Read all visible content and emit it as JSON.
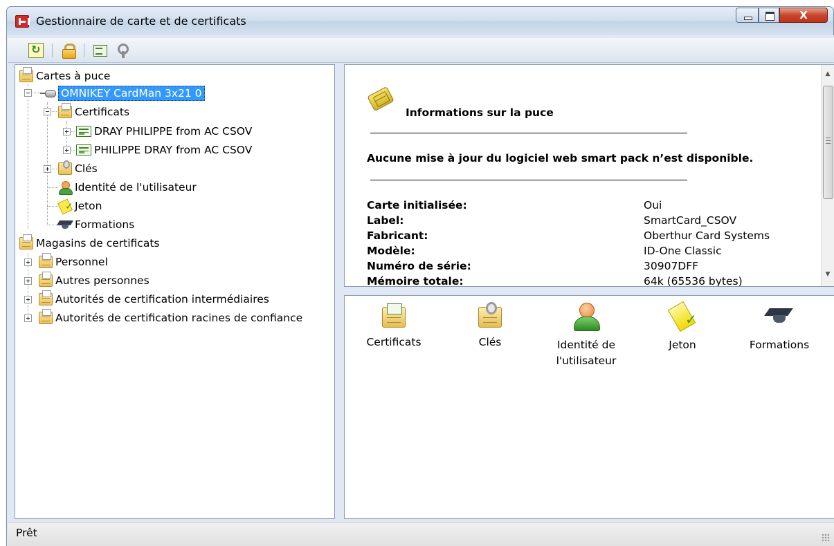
{
  "window": {
    "title": "Gestionnaire de carte et de certificats",
    "close_label": "X"
  },
  "toolbar": {
    "buttons": [
      {
        "icon": "refresh-icon"
      },
      {
        "icon": "lock-icon"
      },
      {
        "icon": "export-certificate-icon"
      },
      {
        "icon": "keys-icon"
      }
    ]
  },
  "tree": {
    "smartcards_root": "Cartes à puce",
    "reader": "OMNIKEY CardMan 3x21 0",
    "certificates_folder": "Certificats",
    "certificates": [
      "DRAY PHILIPPE from AC CSOV",
      "PHILIPPE DRAY from AC CSOV"
    ],
    "keys": "Clés",
    "user_identity": "Identité de l'utilisateur",
    "token": "Jeton",
    "trainings": "Formations",
    "stores_root": "Magasins de certificats",
    "stores": [
      "Personnel",
      "Autres personnes",
      "Autorités de certification intermédiaires",
      "Autorités de certification racines de confiance"
    ]
  },
  "info": {
    "title": "Informations sur la puce",
    "message": "Aucune mise à jour du logiciel web smart pack n’est disponible.",
    "properties": [
      {
        "key": "Carte initialisée:",
        "value": "Oui"
      },
      {
        "key": "Label:",
        "value": "SmartCard_CSOV"
      },
      {
        "key": "Fabricant:",
        "value": "Oberthur Card Systems"
      },
      {
        "key": "Modèle:",
        "value": "ID-One Classic"
      },
      {
        "key": "Numéro de série:",
        "value": "30907DFF"
      },
      {
        "key": "Mémoire totale:",
        "value": "64k (65536 bytes)"
      }
    ]
  },
  "icon_view": {
    "items": [
      {
        "label": "Certificats",
        "icon": "certificates-folder-icon"
      },
      {
        "label": "Clés",
        "icon": "keys-folder-icon"
      },
      {
        "label": "Identité de l'utilisateur",
        "icon": "user-identity-icon"
      },
      {
        "label": "Jeton",
        "icon": "token-icon"
      },
      {
        "label": "Formations",
        "icon": "graduation-cap-icon"
      }
    ]
  },
  "status": {
    "text": "Prêt"
  }
}
